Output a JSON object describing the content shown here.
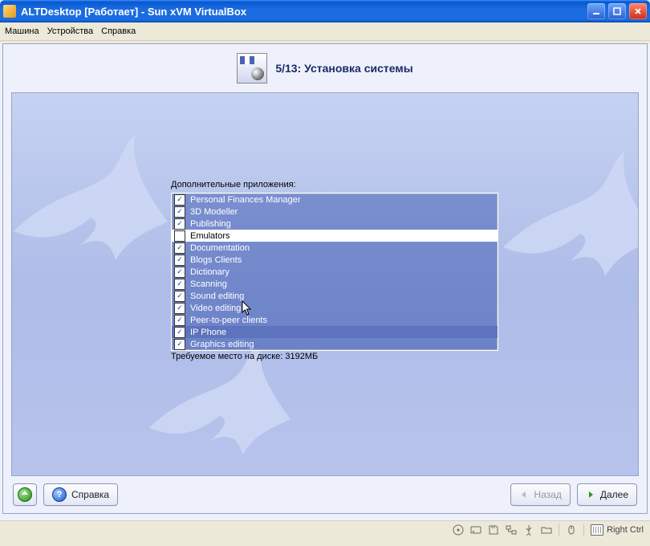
{
  "window": {
    "title": "ALTDesktop [Работает] - Sun xVM VirtualBox"
  },
  "menu": {
    "machine": "Машина",
    "devices": "Устройства",
    "help": "Справка"
  },
  "installer": {
    "step_title": "5/13: Установка системы",
    "apps_label": "Дополнительные приложения:",
    "apps": [
      {
        "label": "Personal Finances Manager",
        "checked": true
      },
      {
        "label": "3D Modeller",
        "checked": true
      },
      {
        "label": "Publishing",
        "checked": true
      },
      {
        "label": "Emulators",
        "checked": false
      },
      {
        "label": "Documentation",
        "checked": true
      },
      {
        "label": "Blogs Clients",
        "checked": true
      },
      {
        "label": "Dictionary",
        "checked": true
      },
      {
        "label": "Scanning",
        "checked": true
      },
      {
        "label": "Sound editing",
        "checked": true
      },
      {
        "label": "Video editing",
        "checked": true
      },
      {
        "label": "Peer-to-peer clients",
        "checked": true
      },
      {
        "label": "IP Phone",
        "checked": true,
        "highlight": true
      },
      {
        "label": "Graphics editing",
        "checked": true
      }
    ],
    "disk_label": "Требуемое место на диске: 3192МБ",
    "footer": {
      "help": "Справка",
      "back": "Назад",
      "next": "Далее"
    }
  },
  "statusbar": {
    "host_key": "Right Ctrl"
  }
}
